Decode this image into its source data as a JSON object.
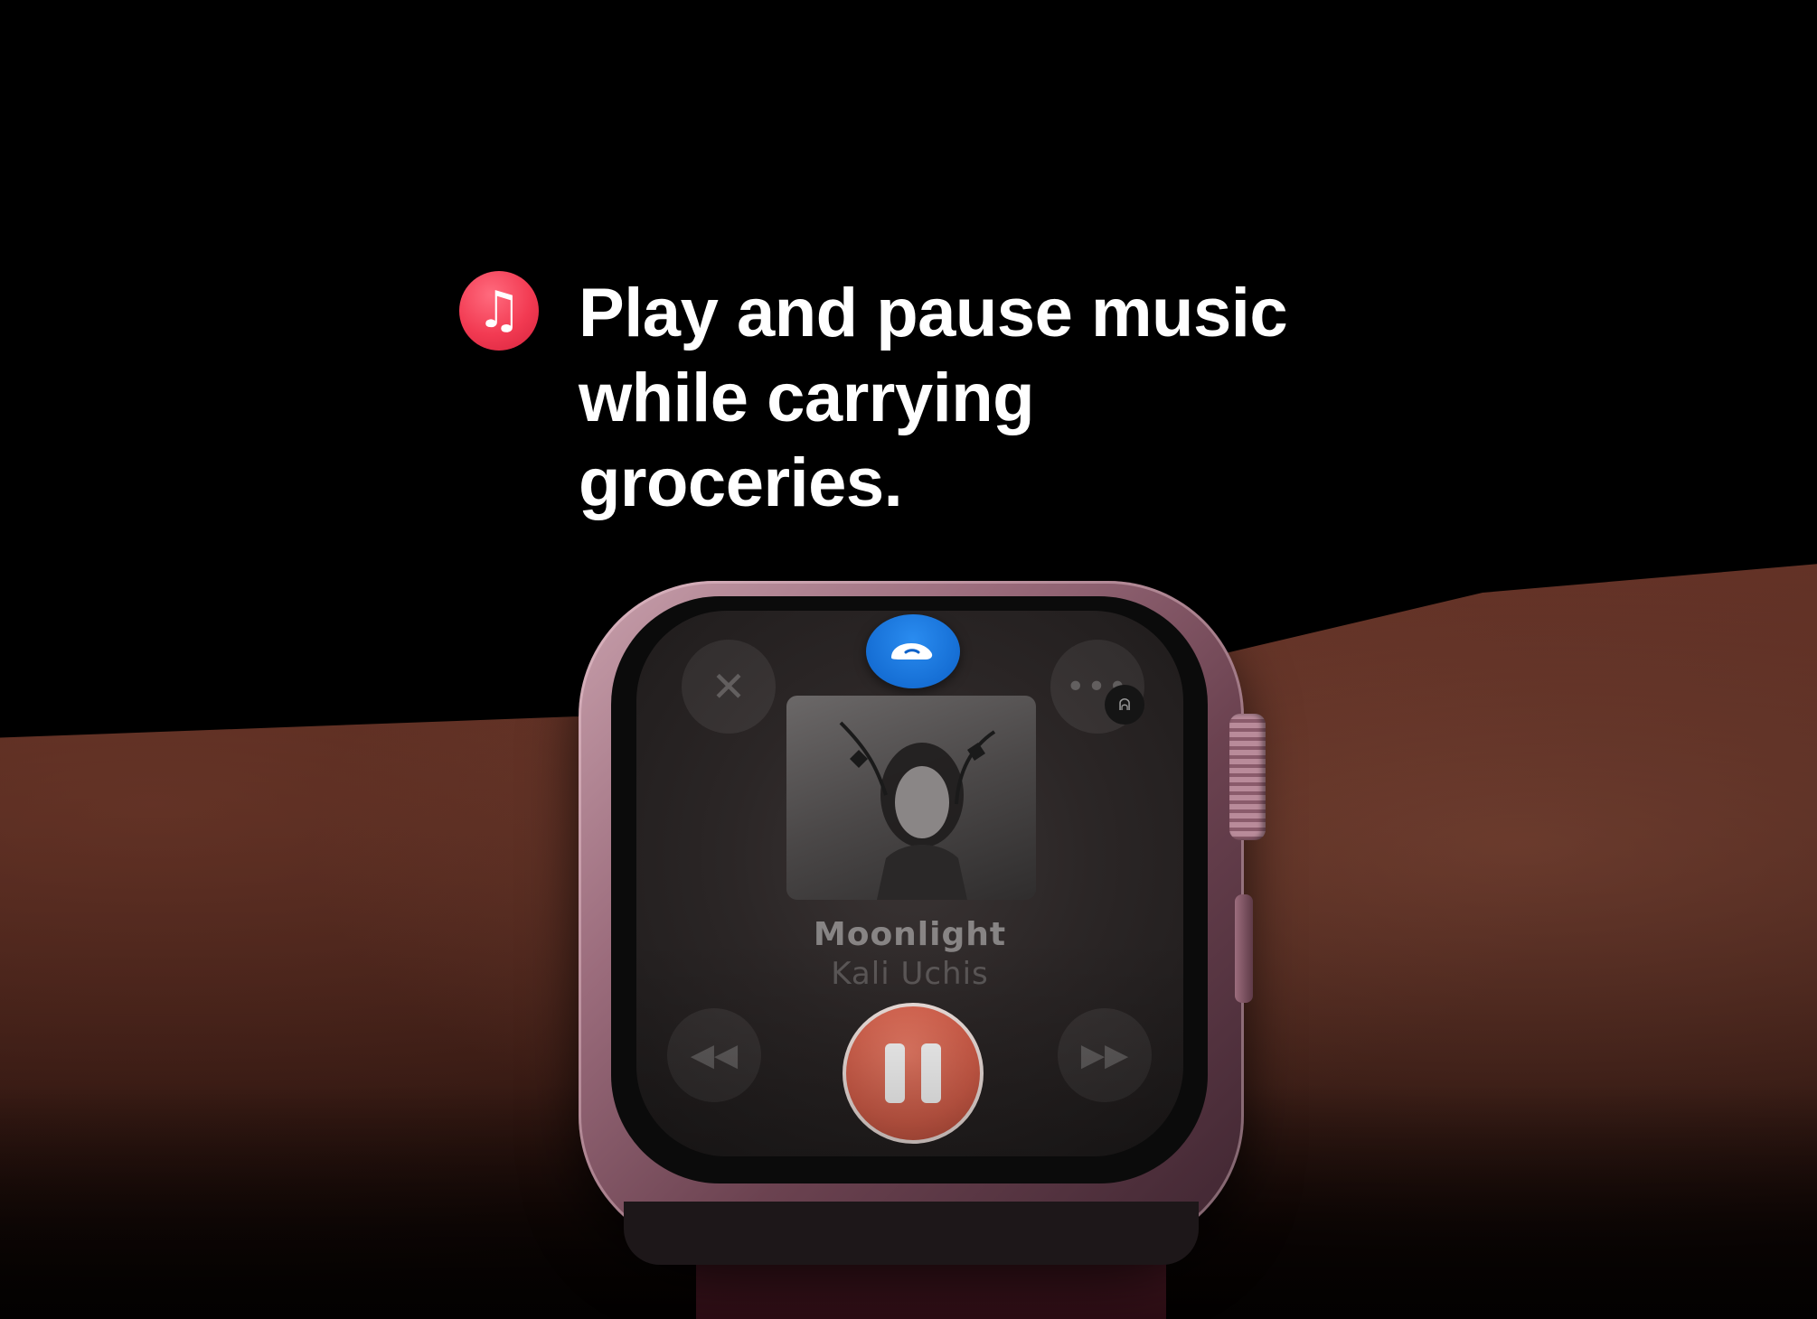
{
  "headline": {
    "text": "Play and pause music while carrying groceries.",
    "icon": "music-note-icon",
    "icon_color": "#f23a52"
  },
  "watch": {
    "case_color": "#b98b9a",
    "now_playing": {
      "title": "Moonlight",
      "artist": "Kali Uchis",
      "accent_color": "#d8604b"
    },
    "controls": {
      "close_icon": "close-icon",
      "more_icon": "more-icon",
      "gesture_icon": "double-tap-gesture-icon",
      "airpods_icon": "airpods-icon",
      "rewind_icon": "rewind-icon",
      "pause_icon": "pause-icon",
      "forward_icon": "fast-forward-icon"
    }
  }
}
